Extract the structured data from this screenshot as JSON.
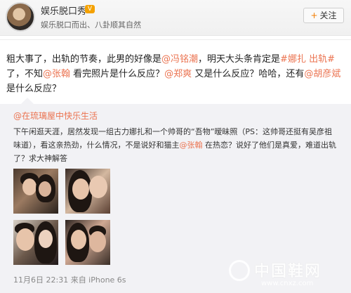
{
  "header": {
    "name": "娱乐脱口秀",
    "vip_badge": "V",
    "bio": "娱乐脱口而出、八卦顺其自然",
    "follow_plus": "+",
    "follow_label": "关注"
  },
  "post": {
    "t1": "粗大事了，出轨的节奏，此男的好像是",
    "m1": "@冯铭潮",
    "t2": "，明天大头条肯定是",
    "topic1": "#娜扎 出轨#",
    "t3": "了，不知",
    "m2": "@张翰",
    "t4": " 看完照片是什么反应？",
    "m3": "@郑爽",
    "t5": " 又是什么反应？哈哈，还有",
    "m4": "@胡彦斌",
    "t6": " 是什么反应？"
  },
  "repost": {
    "author": "@在琉璃屋中快乐生活",
    "r1": "下午闲逛天涯，居然发现一组古力娜扎和一个帅哥的“吾物”暧昧照（PS：这帅哥还挺有吴彦祖味道），看这亲热劲，什么情况，不是说好和猫主",
    "rm": "@张翰",
    "r2": " 在热恋？说好了他们是真爱，难道出轨了？求大神解答",
    "time": "11月6日 22:31 来自 iPhone 6s"
  },
  "watermark": {
    "text": "中国鞋网",
    "url": "www.cnxz.com"
  }
}
